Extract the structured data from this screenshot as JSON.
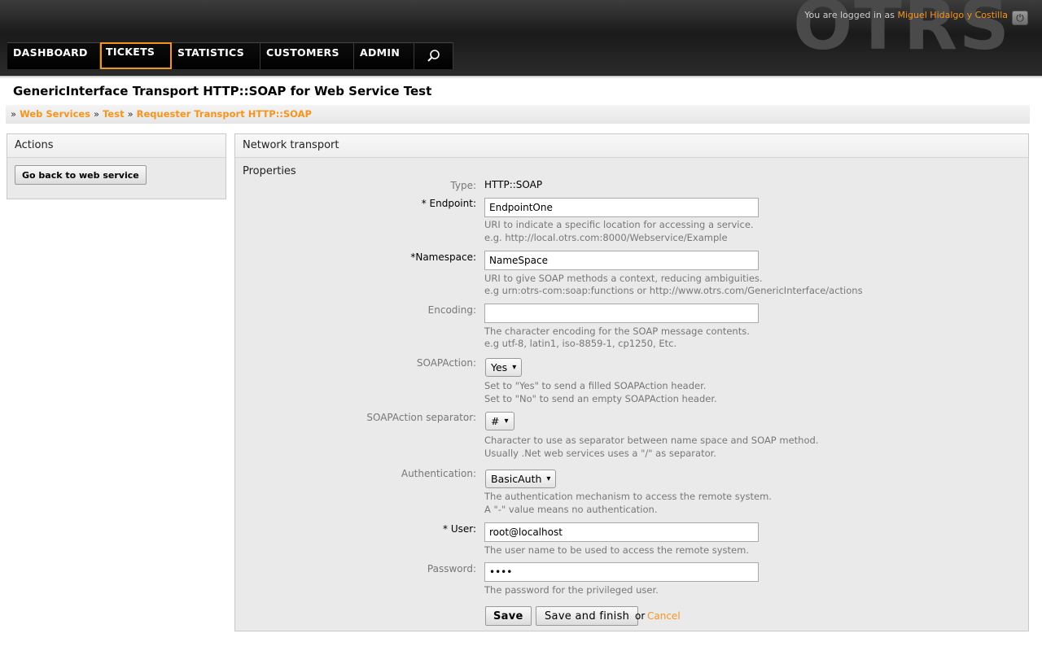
{
  "header": {
    "logo_text": "OTRS",
    "login_prefix": "You are logged in as",
    "user_name": "Miguel Hidalgo y Costilla",
    "logout_icon": "⏻"
  },
  "nav": {
    "items": [
      {
        "label": "DASHBOARD",
        "selected": false
      },
      {
        "label": "TICKETS",
        "selected": true
      },
      {
        "label": "STATISTICS",
        "selected": false
      },
      {
        "label": "CUSTOMERS",
        "selected": false
      },
      {
        "label": "ADMIN",
        "selected": false
      }
    ],
    "search_icon": "search-icon"
  },
  "page_title": "GenericInterface Transport HTTP::SOAP for Web Service Test",
  "breadcrumb": {
    "sep": "»",
    "items": [
      "Web Services",
      "Test",
      "Requester Transport HTTP::SOAP"
    ]
  },
  "actions": {
    "title": "Actions",
    "back_button": "Go back to web service"
  },
  "transport": {
    "title": "Network transport",
    "properties_title": "Properties",
    "type": {
      "label": "Type:",
      "value": "HTTP::SOAP"
    },
    "endpoint": {
      "label": "Endpoint:",
      "required_mark": "*",
      "value": "EndpointOne",
      "hint1": "URI to indicate a specific location for accessing a service.",
      "hint2": "e.g. http://local.otrs.com:8000/Webservice/Example"
    },
    "namespace": {
      "label": "Namespace:",
      "required_mark": "*",
      "value": "NameSpace",
      "hint1": "URI to give SOAP methods a context, reducing ambiguities.",
      "hint2": "e.g urn:otrs-com:soap:functions or http://www.otrs.com/GenericInterface/actions"
    },
    "encoding": {
      "label": "Encoding:",
      "value": "",
      "hint1": "The character encoding for the SOAP message contents.",
      "hint2": "e.g utf-8, latin1, iso-8859-1, cp1250, Etc."
    },
    "soapaction": {
      "label": "SOAPAction:",
      "value": "Yes",
      "hint1": "Set to \"Yes\" to send a filled SOAPAction header.",
      "hint2": "Set to \"No\" to send an empty SOAPAction header."
    },
    "soapaction_separator": {
      "label": "SOAPAction separator:",
      "value": "#",
      "hint1": "Character to use as separator between name space and SOAP method.",
      "hint2": "Usually .Net web services uses a \"/\" as separator."
    },
    "authentication": {
      "label": "Authentication:",
      "value": "BasicAuth",
      "hint1": "The authentication mechanism to access the remote system.",
      "hint2": "A \"-\" value means no authentication."
    },
    "user": {
      "label": "User:",
      "required_mark": "*",
      "value": "root@localhost",
      "hint1": "The user name to be used to access the remote system."
    },
    "password": {
      "label": "Password:",
      "value": "••••",
      "hint1": "The password for the privileged user."
    },
    "save_label": "Save",
    "save_finish_label": "Save and finish",
    "or_text": "or",
    "cancel_label": "Cancel"
  },
  "colors": {
    "accent": "#f7941d",
    "header_bg": "#1a1a1a",
    "panel_bg": "#eaeaea"
  }
}
